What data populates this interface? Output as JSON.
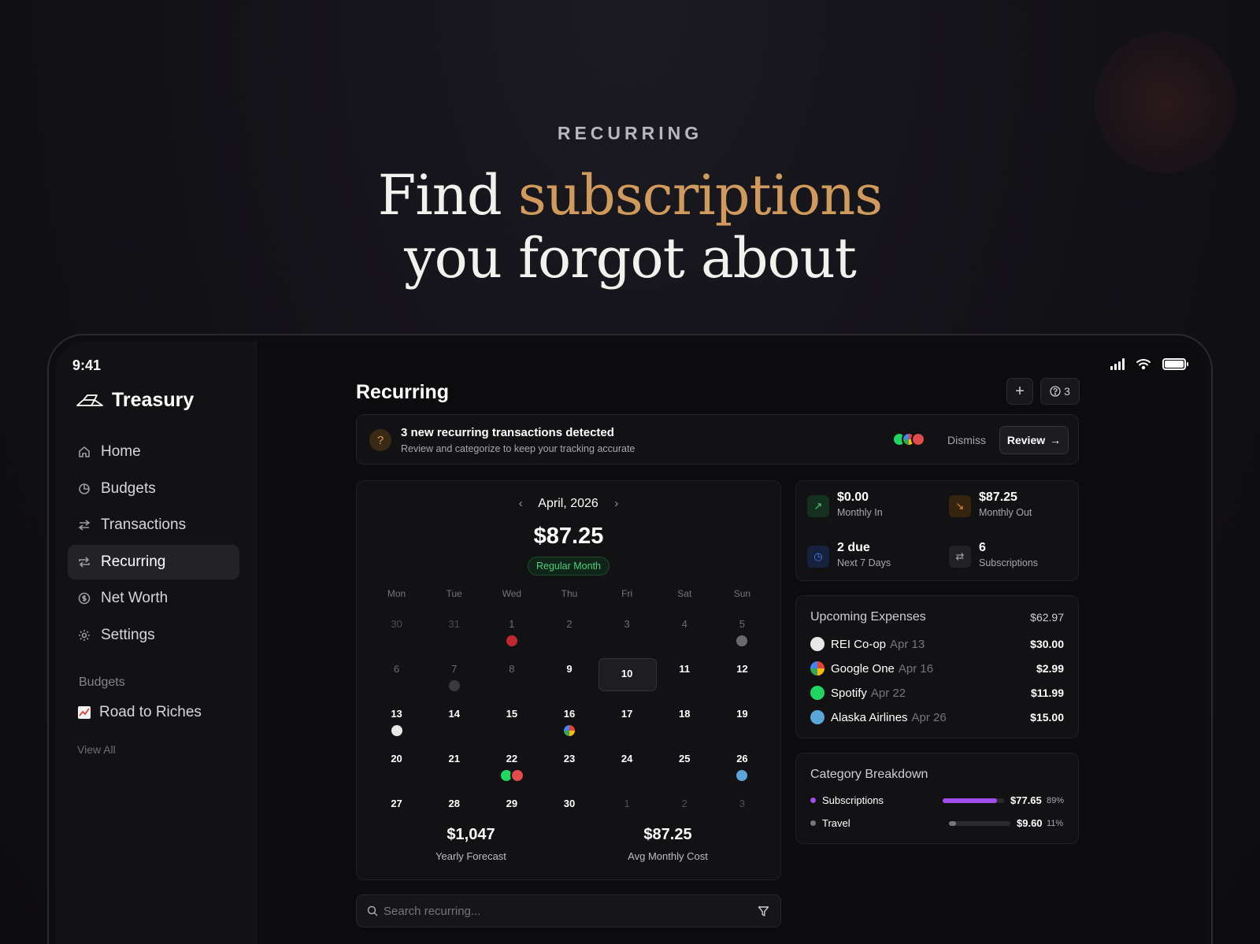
{
  "hero": {
    "eyebrow": "RECURRING",
    "headline_a": "Find ",
    "headline_accent": "subscriptions",
    "headline_b": "you forgot about"
  },
  "status": {
    "time": "9:41"
  },
  "brand": {
    "name": "Treasury",
    "icon": "gold-bars-icon"
  },
  "nav": [
    {
      "label": "Home",
      "icon": "home-icon"
    },
    {
      "label": "Budgets",
      "icon": "pie-icon"
    },
    {
      "label": "Transactions",
      "icon": "swap-icon"
    },
    {
      "label": "Recurring",
      "icon": "repeat-icon",
      "active": true
    },
    {
      "label": "Net Worth",
      "icon": "dollar-circle-icon"
    },
    {
      "label": "Settings",
      "icon": "gear-icon"
    }
  ],
  "sidebar": {
    "section_title": "Budgets",
    "budget_item": "Road to Riches",
    "view_all": "View All"
  },
  "header": {
    "title": "Recurring",
    "add": "+",
    "help_count": "3"
  },
  "banner": {
    "title": "3 new recurring transactions detected",
    "subtitle": "Review and categorize to keep your tracking accurate",
    "dismiss": "Dismiss",
    "review": "Review"
  },
  "calendar": {
    "month": "April, 2026",
    "total": "$87.25",
    "badge": "Regular Month",
    "weekdays": [
      "Mon",
      "Tue",
      "Wed",
      "Thu",
      "Fri",
      "Sat",
      "Sun"
    ],
    "days": [
      "30",
      "31",
      "1",
      "2",
      "3",
      "4",
      "5",
      "6",
      "7",
      "8",
      "9",
      "10",
      "11",
      "12",
      "13",
      "14",
      "15",
      "16",
      "17",
      "18",
      "19",
      "20",
      "21",
      "22",
      "23",
      "24",
      "25",
      "26",
      "27",
      "28",
      "29",
      "30",
      "1",
      "2",
      "3"
    ],
    "yearly_value": "$1,047",
    "yearly_label": "Yearly Forecast",
    "avg_value": "$87.25",
    "avg_label": "Avg Monthly Cost"
  },
  "stats": [
    {
      "value": "$0.00",
      "label": "Monthly In",
      "color": "#4fce7a"
    },
    {
      "value": "$87.25",
      "label": "Monthly Out",
      "color": "#e8913a"
    },
    {
      "value": "2 due",
      "label": "Next 7 Days",
      "color": "#4a7de8"
    },
    {
      "value": "6",
      "label": "Subscriptions",
      "color": "#a9a7ad"
    }
  ],
  "upcoming": {
    "title": "Upcoming Expenses",
    "total": "$62.97",
    "items": [
      {
        "name": "REI Co-op",
        "date": "Apr 13",
        "amount": "$30.00",
        "color": "#e8e8e8"
      },
      {
        "name": "Google One",
        "date": "Apr 16",
        "amount": "$2.99",
        "color": "#4285f4"
      },
      {
        "name": "Spotify",
        "date": "Apr 22",
        "amount": "$11.99",
        "color": "#1ed760"
      },
      {
        "name": "Alaska Airlines",
        "date": "Apr 26",
        "amount": "$15.00",
        "color": "#5aa6d8"
      }
    ]
  },
  "category": {
    "title": "Category Breakdown",
    "items": [
      {
        "name": "Subscriptions",
        "amount": "$77.65",
        "pct": "89%",
        "fraction": 0.89,
        "color": "#a24df0"
      },
      {
        "name": "Travel",
        "amount": "$9.60",
        "pct": "11%",
        "fraction": 0.11,
        "color": "#77757b"
      }
    ]
  },
  "search": {
    "placeholder": "Search recurring..."
  }
}
